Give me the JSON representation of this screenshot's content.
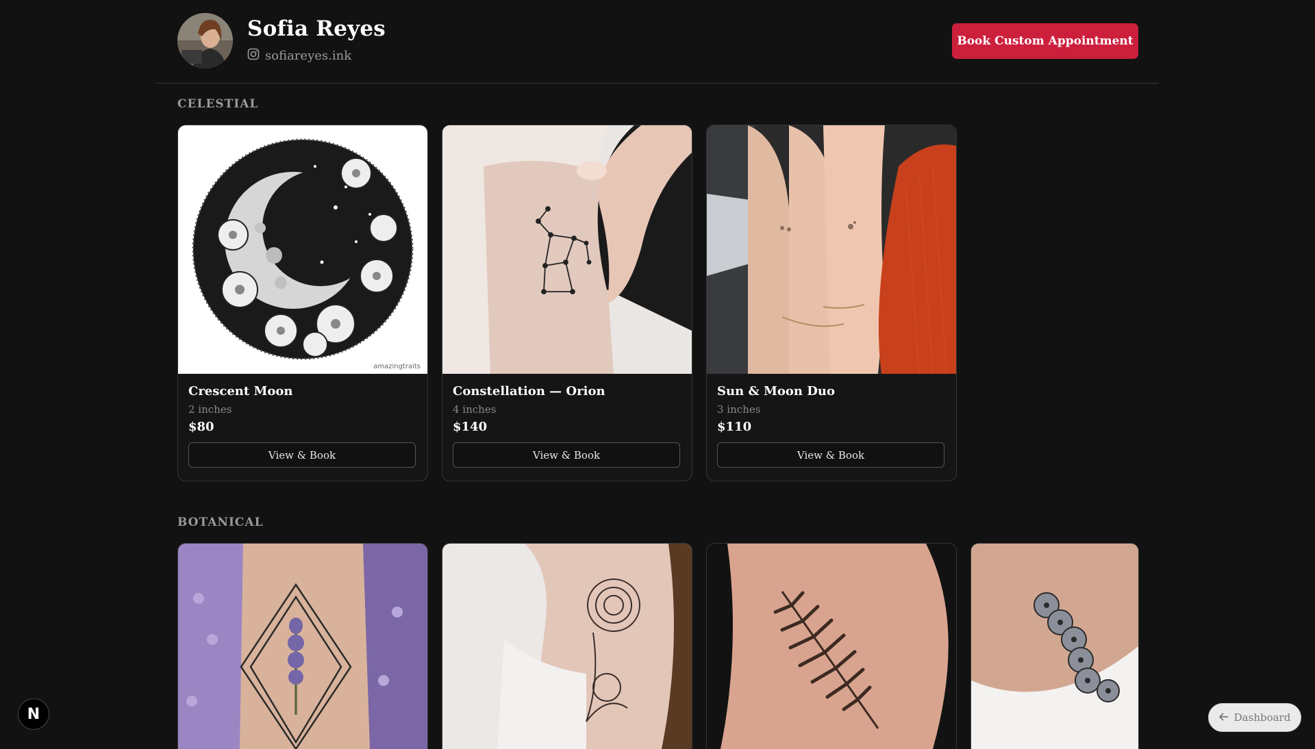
{
  "profile": {
    "name": "Sofia Reyes",
    "handle": "sofiareyes.ink",
    "cta_label": "Book Custom Appointment"
  },
  "sections": [
    {
      "title": "CELESTIAL",
      "cards": [
        {
          "title": "Crescent Moon",
          "size": "2 inches",
          "price": "$80",
          "button": "View & Book",
          "watermark": "amazingtraits"
        },
        {
          "title": "Constellation — Orion",
          "size": "4 inches",
          "price": "$140",
          "button": "View & Book"
        },
        {
          "title": "Sun & Moon Duo",
          "size": "3 inches",
          "price": "$110",
          "button": "View & Book"
        }
      ]
    },
    {
      "title": "BOTANICAL",
      "cards": [
        {
          "image": "lavender tattoo"
        },
        {
          "image": "peony shoulder tattoo"
        },
        {
          "image": "fern tattoo"
        },
        {
          "image": "daisy chain tattoo"
        }
      ]
    }
  ],
  "dashboard_label": "Dashboard",
  "badge_label": "N",
  "colors": {
    "background": "#121212",
    "accent": "#cc1f3c"
  }
}
